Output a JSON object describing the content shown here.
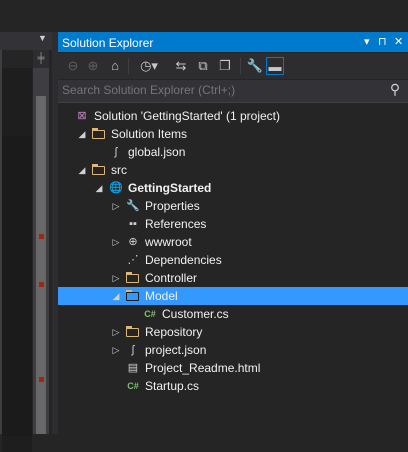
{
  "panel": {
    "title": "Solution Explorer",
    "title_buttons": [
      "▾",
      "⊓",
      "✕"
    ]
  },
  "toolbar": {
    "icons": [
      "back-icon",
      "forward-icon",
      "home-icon",
      "history-icon",
      "sync-icon",
      "collapse-all-icon",
      "show-all-files-icon",
      "properties-icon",
      "preview-icon"
    ]
  },
  "search": {
    "placeholder": "Search Solution Explorer (Ctrl+;)"
  },
  "tree": [
    {
      "label": "Solution 'GettingStarted' (1 project)",
      "icon": "solution-icon",
      "expander": "",
      "bold": false,
      "selected": false
    },
    {
      "label": "Solution Items",
      "icon": "folder-icon",
      "expander": "expanded",
      "bold": false,
      "selected": false
    },
    {
      "label": "global.json",
      "icon": "json-file-icon",
      "expander": "",
      "bold": false,
      "selected": false
    },
    {
      "label": "src",
      "icon": "folder-icon",
      "expander": "expanded",
      "bold": false,
      "selected": false
    },
    {
      "label": "GettingStarted",
      "icon": "web-project-icon",
      "expander": "expanded",
      "bold": true,
      "selected": false
    },
    {
      "label": "Properties",
      "icon": "wrench-icon",
      "expander": "collapsed",
      "bold": false,
      "selected": false
    },
    {
      "label": "References",
      "icon": "references-icon",
      "expander": "",
      "bold": false,
      "selected": false
    },
    {
      "label": "wwwroot",
      "icon": "globe-icon",
      "expander": "collapsed",
      "bold": false,
      "selected": false
    },
    {
      "label": "Dependencies",
      "icon": "dependencies-icon",
      "expander": "",
      "bold": false,
      "selected": false
    },
    {
      "label": "Controller",
      "icon": "folder-icon",
      "expander": "collapsed",
      "bold": false,
      "selected": false
    },
    {
      "label": "Model",
      "icon": "folder-open-icon",
      "expander": "expanded",
      "bold": false,
      "selected": true
    },
    {
      "label": "Customer.cs",
      "icon": "csharp-file-icon",
      "expander": "",
      "bold": false,
      "selected": false
    },
    {
      "label": "Repository",
      "icon": "folder-icon",
      "expander": "collapsed",
      "bold": false,
      "selected": false
    },
    {
      "label": "project.json",
      "icon": "json-file-icon",
      "expander": "collapsed",
      "bold": false,
      "selected": false
    },
    {
      "label": "Project_Readme.html",
      "icon": "html-file-icon",
      "expander": "",
      "bold": false,
      "selected": false
    },
    {
      "label": "Startup.cs",
      "icon": "csharp-file-icon",
      "expander": "",
      "bold": false,
      "selected": false
    }
  ],
  "colors": {
    "accent": "#007acc",
    "selection": "#3399ff",
    "folder": "#dcb67a",
    "csharp": "#68217a"
  }
}
